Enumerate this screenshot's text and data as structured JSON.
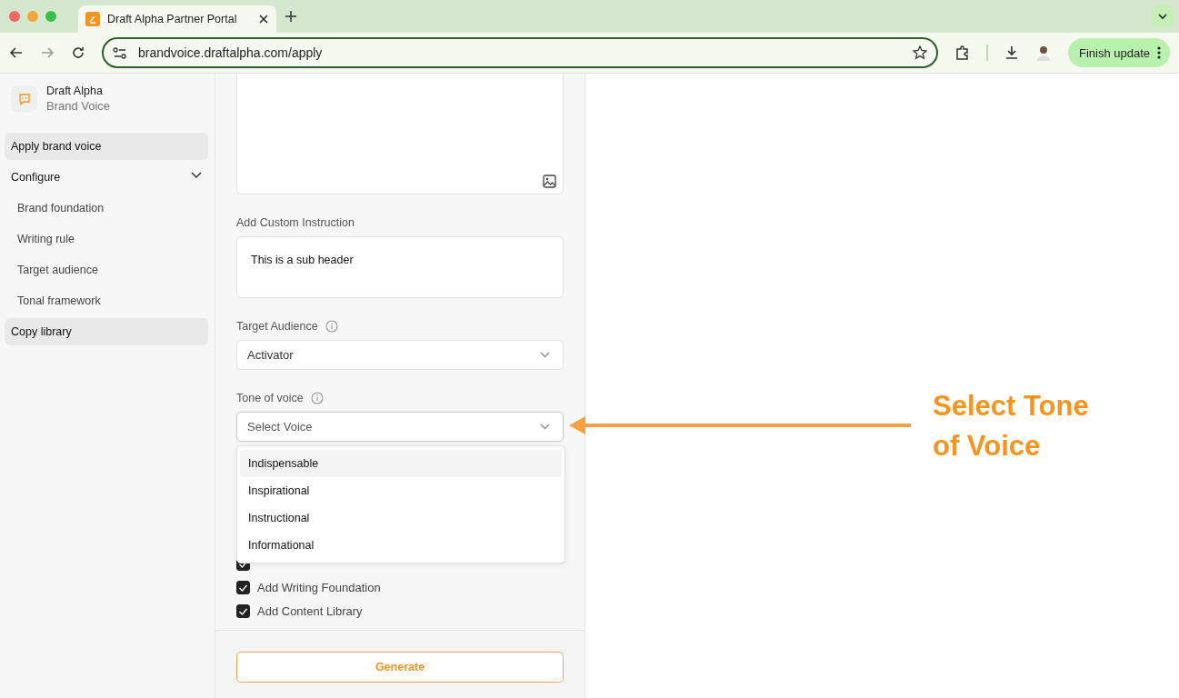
{
  "browser": {
    "tab_title": "Draft Alpha Partner Portal",
    "url": "brandvoice.draftalpha.com/apply",
    "update_button": "Finish update"
  },
  "sidebar": {
    "brand_name": "Draft Alpha",
    "product": "Brand Voice",
    "items": [
      {
        "kind": "link",
        "label": "Apply brand voice",
        "highlighted": true
      },
      {
        "kind": "group",
        "label": "Configure",
        "expanded": true,
        "children": [
          {
            "label": "Brand foundation"
          },
          {
            "label": "Writing rule"
          },
          {
            "label": "Target audience"
          },
          {
            "label": "Tonal framework"
          }
        ]
      },
      {
        "kind": "link",
        "label": "Copy library",
        "highlighted": true
      }
    ]
  },
  "form": {
    "fields": [
      {
        "kind": "image_upload"
      },
      {
        "kind": "textarea",
        "label": "Add Custom Instruction",
        "value": "This is a sub header"
      },
      {
        "kind": "select",
        "label": "Target Audience",
        "info": true,
        "value": "Activator",
        "open": false
      },
      {
        "kind": "select",
        "label": "Tone of voice",
        "info": true,
        "placeholder": "Select Voice",
        "open": true,
        "options": [
          {
            "label": "Indispensable",
            "highlighted": true
          },
          {
            "label": "Inspirational",
            "highlighted": false
          },
          {
            "label": "Instructional",
            "highlighted": false
          },
          {
            "label": "Informational",
            "highlighted": false
          }
        ]
      }
    ],
    "checkboxes": [
      {
        "checked": true
      },
      {
        "label": "Add Writing Foundation",
        "checked": true
      },
      {
        "label": "Add Content Library",
        "checked": true
      }
    ],
    "generate_button": "Generate"
  },
  "annotation": {
    "text": "Select Tone of Voice"
  }
}
